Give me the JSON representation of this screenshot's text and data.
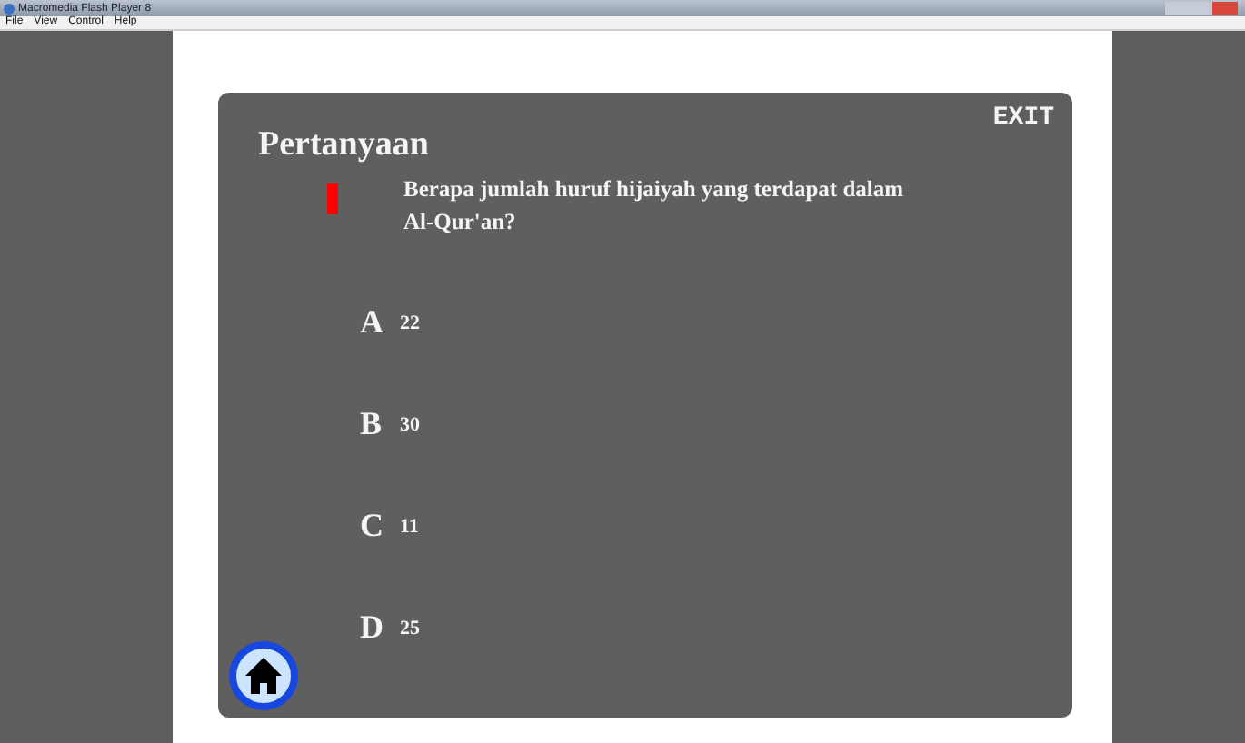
{
  "window": {
    "title": "Macromedia Flash Player 8"
  },
  "menu": [
    "File",
    "View",
    "Control",
    "Help"
  ],
  "card": {
    "heading": "Pertanyaan",
    "exit": "EXIT",
    "question": "Berapa jumlah huruf hijaiyah yang terdapat dalam Al-Qur'an?",
    "options": [
      {
        "letter": "A",
        "text": "22"
      },
      {
        "letter": "B",
        "text": "30"
      },
      {
        "letter": "C",
        "text": "11"
      },
      {
        "letter": "D",
        "text": "25"
      }
    ]
  }
}
